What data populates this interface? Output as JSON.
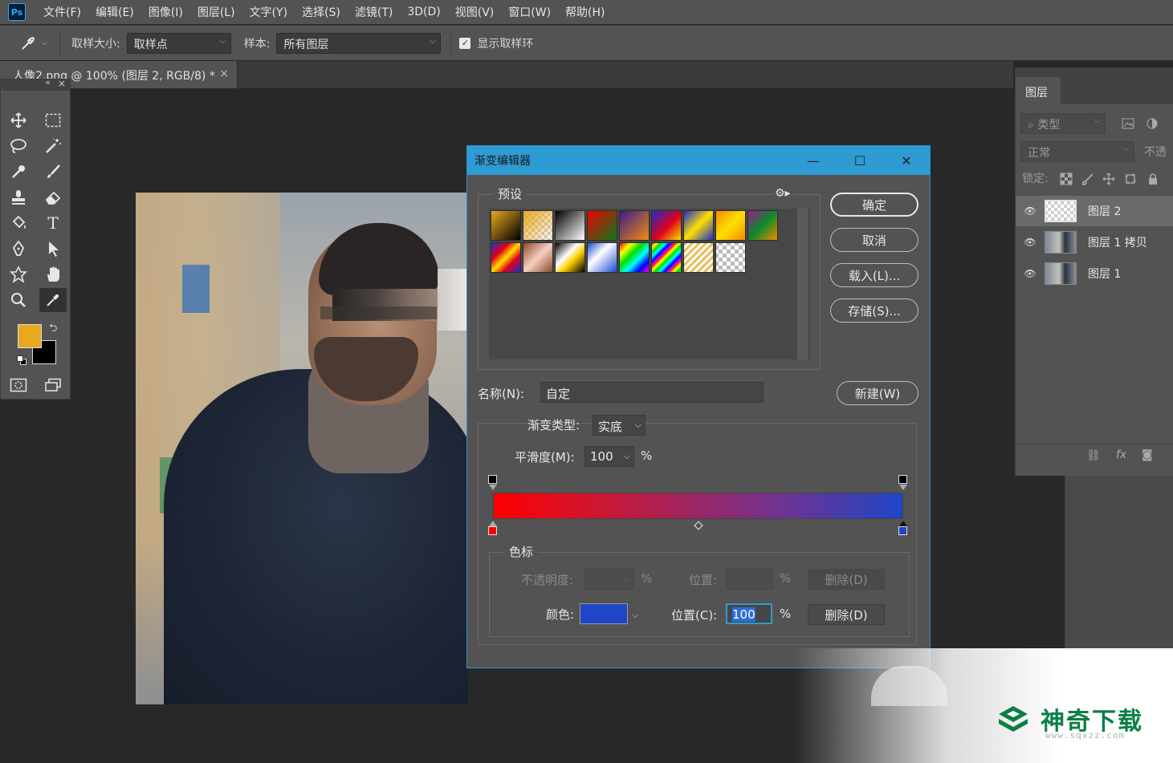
{
  "app": {
    "logo": "Ps"
  },
  "menu": [
    "文件(F)",
    "编辑(E)",
    "图像(I)",
    "图层(L)",
    "文字(Y)",
    "选择(S)",
    "滤镜(T)",
    "3D(D)",
    "视图(V)",
    "窗口(W)",
    "帮助(H)"
  ],
  "options": {
    "tool_icon": "eyedropper-icon",
    "sample_size_label": "取样大小:",
    "sample_size_value": "取样点",
    "sample_label": "样本:",
    "sample_value": "所有图层",
    "show_ring_label": "显示取样环",
    "show_ring_checked": true
  },
  "document": {
    "tab_title": "人像2.png @ 100% (图层 2, RGB/8) *",
    "close": "×"
  },
  "toolbar": {
    "collapse": "«",
    "close": "×",
    "tools": [
      "move-icon",
      "marquee-icon",
      "lasso-icon",
      "magic-wand-icon",
      "eyedropper-icon",
      "brush-icon",
      "stamp-icon",
      "eraser-icon",
      "paint-bucket-icon",
      "type-icon",
      "pen-icon",
      "path-select-icon",
      "custom-shape-icon",
      "hand-icon",
      "zoom-icon",
      "eyedropper-active-icon"
    ],
    "type_glyph": "T",
    "foreground_color": "#e8a91e",
    "background_color": "#000000"
  },
  "layers_panel": {
    "tab": "图层",
    "filter_placeholder": "类型",
    "blend_mode": "正常",
    "opacity_label": "不透",
    "lock_label": "锁定:",
    "layers": [
      {
        "name": "图层 2",
        "thumb": "transparent",
        "selected": true
      },
      {
        "name": "图层 1 拷贝",
        "thumb": "photo",
        "selected": false
      },
      {
        "name": "图层 1",
        "thumb": "photo",
        "selected": false
      }
    ],
    "footer_fx": "fx"
  },
  "gradient_editor": {
    "title": "渐变编辑器",
    "presets_label": "预设",
    "buttons": {
      "ok": "确定",
      "cancel": "取消",
      "load": "载入(L)...",
      "save": "存储(S)...",
      "new": "新建(W)"
    },
    "name_label": "名称(N):",
    "name_value": "自定",
    "gradient_type_label": "渐变类型:",
    "gradient_type_value": "实底",
    "smoothness_label": "平滑度(M):",
    "smoothness_value": "100",
    "percent": "%",
    "stops_group_label": "色标",
    "opacity_label": "不透明度:",
    "opacity_position_label": "位置:",
    "delete_label": "删除(D)",
    "color_label": "颜色:",
    "color_value": "#1f46c8",
    "color_position_label": "位置(C):",
    "color_position_value": "100",
    "color_stops": [
      {
        "position": 0,
        "color": "#ff0000"
      },
      {
        "position": 100,
        "color": "#1f46c8"
      }
    ],
    "opacity_stops": [
      {
        "position": 0,
        "opacity": 100
      },
      {
        "position": 100,
        "opacity": 100
      }
    ],
    "midpoint": 50
  },
  "watermark": {
    "brand": "神奇下载",
    "url": "www.sqxzz.com",
    "color": "#0b7f44"
  }
}
